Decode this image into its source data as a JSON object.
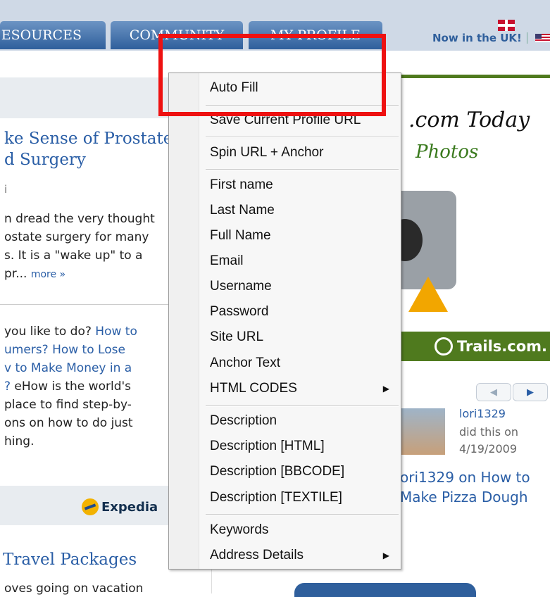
{
  "nav": {
    "tabs": [
      {
        "label": "ESOURCES"
      },
      {
        "label": "COMMUNITY"
      },
      {
        "label": "MY PROFILE"
      }
    ],
    "now_in_uk": "Now in the UK!"
  },
  "left": {
    "headline_1": "ke Sense of Prostate",
    "headline_2": "d Surgery",
    "author": "i",
    "snippet": [
      "n dread the very thought",
      "ostate surgery for many",
      "s. It is a \"wake up\" to a",
      "pr..."
    ],
    "more": "more »",
    "snippet2": {
      "l1_text": "you like to do? ",
      "l1_link": "How to",
      "l2_link": "umers?  How to Lose",
      "l3_link": "v to Make Money in a",
      "l4_pre": "?",
      "l4_text": "  eHow is the world's",
      "l5": " place to find step-by-",
      "l6": "ons on how to do just",
      "l7": "hing."
    },
    "expedia": "Expedia",
    "travel": "Travel Packages",
    "loves": "oves going on vacation"
  },
  "right": {
    "ad_title": ".com Today",
    "ad_subtitle": "Photos",
    "ad_brand": "Trails.com.",
    "user": "lori1329",
    "did": "did this on",
    "date": "4/19/2009",
    "activity_1": "ori1329 on How to",
    "activity_2": "Make Pizza Dough"
  },
  "context_menu": {
    "auto_fill": "Auto Fill",
    "save_profile": "Save Current Profile URL",
    "spin_url": "Spin URL + Anchor",
    "first_name": "First name",
    "last_name": "Last Name",
    "full_name": "Full Name",
    "email": "Email",
    "username": "Username",
    "password": "Password",
    "site_url": "Site URL",
    "anchor_text": "Anchor Text",
    "html_codes": "HTML CODES",
    "description": "Description",
    "description_html": "Description [HTML]",
    "description_bbcode": "Description [BBCODE]",
    "description_textile": "Description [TEXTILE]",
    "keywords": "Keywords",
    "address_details": "Address Details"
  },
  "colors": {
    "highlight_box": "#ee1111",
    "link": "#2a5ea6",
    "nav_tab": "#2f5f9c"
  }
}
